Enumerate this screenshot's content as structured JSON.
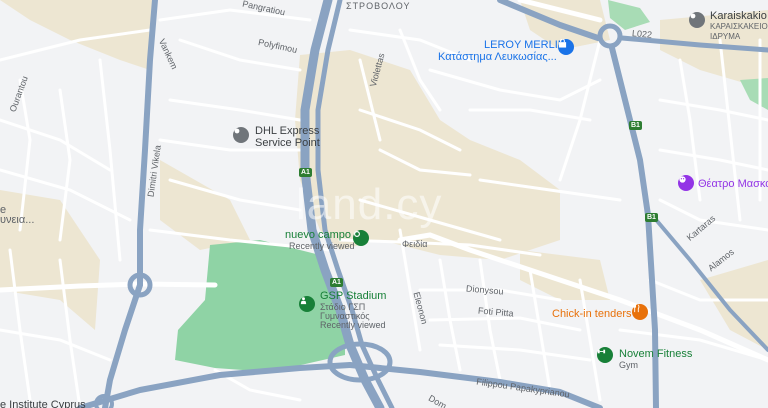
{
  "map": {
    "districts": {
      "strovolos": "ΣΤΡΟΒΟΛΟΥ"
    },
    "streets": {
      "pangratiou": "Pangratiou",
      "polyfimou": "Polyfimou",
      "vankem": "Vankem",
      "ourantou": "Ourantou",
      "violettas": "Violettas",
      "dimitri_vikela": "Dimitri Vikela",
      "feidia": "Φειδία",
      "dionysou": "Dionysou",
      "eleonon": "Eleonon",
      "foti_pitta": "Foti Pitta",
      "filippou": "Filippou Papakyprianou",
      "kartaras": "Kartaras",
      "alamos": "Alamos",
      "dom": "Dom",
      "yneia": "υνεια..."
    },
    "road_shields": {
      "a1_north": "A1",
      "a1_south": "A1",
      "b1_north": "B1",
      "b1_south": "B1",
      "l022": "L022"
    },
    "pois": {
      "leroy_merlin": {
        "name": "LEROY MERLIN",
        "subtitle": "Κατάστημα Λευκωσίας..."
      },
      "dhl": {
        "name_line1": "DHL Express",
        "name_line2": "Service Point"
      },
      "karaiskakio": {
        "name": "Karaiskakio",
        "subtitle": "ΚΑΡΑΙΣΚΑΚΕΙΟ ΙΔΡΥΜΑ"
      },
      "theatro": {
        "name": "Θέατρο Μασκα"
      },
      "nuevo_campo": {
        "name": "nuevo campo",
        "subtitle": "Recently viewed"
      },
      "gsp_stadium": {
        "name": "GSP Stadium",
        "subtitle1": "Στάδιο ΓΣΠ",
        "subtitle2": "Γυμναστικός",
        "subtitle3": "Recently viewed"
      },
      "chick_in": {
        "name": "Chick-in tenders"
      },
      "novem": {
        "name": "Novem Fitness",
        "subtitle": "Gym"
      },
      "institute": {
        "name": "e Institute Cyprus"
      },
      "left_partial": {
        "name": "e"
      }
    },
    "watermark": "land.cy",
    "icons": {
      "leroy_merlin": "shopping-bag-icon",
      "dhl": "location-pin-icon",
      "karaiskakio": "location-pin-icon",
      "theatro": "theater-icon",
      "nuevo_campo": "place-icon",
      "gsp_stadium": "stadium-icon",
      "chick_in": "restaurant-icon",
      "novem": "gym-icon"
    },
    "colors": {
      "land": "#f2f3f5",
      "sand": "#ede6d2",
      "park": "#8fd3a5",
      "highway": "#8aa3c2",
      "road": "#ffffff",
      "poi_blue": "#1a73e8",
      "poi_green": "#188038",
      "poi_orange": "#e8710a",
      "poi_purple": "#9334e6",
      "poi_gray": "#70757a"
    }
  }
}
